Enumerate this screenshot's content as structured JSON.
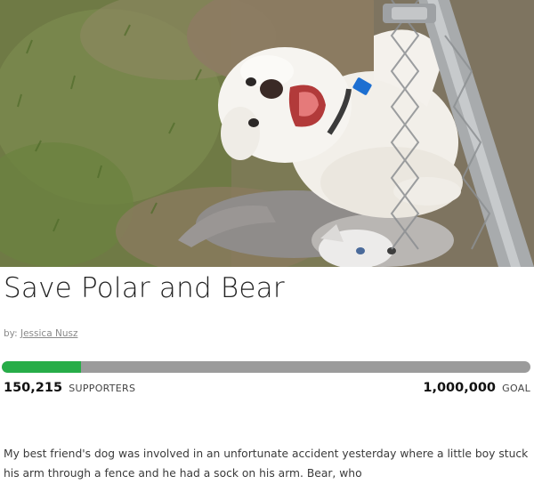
{
  "campaign": {
    "title": "Save Polar and Bear",
    "byline_prefix": "by:",
    "author": "Jessica Nusz",
    "supporters_count": "150,215",
    "supporters_label": "SUPPORTERS",
    "goal_count": "1,000,000",
    "goal_label": "GOAL",
    "progress_fraction": 0.15,
    "description": "My best friend's dog was involved in an unfortunate accident yesterday where a little boy stuck his arm through a fence and he had a sock on his arm. Bear, who"
  },
  "colors": {
    "progress_fill": "#27ad48",
    "progress_track": "#9b9b9b"
  }
}
